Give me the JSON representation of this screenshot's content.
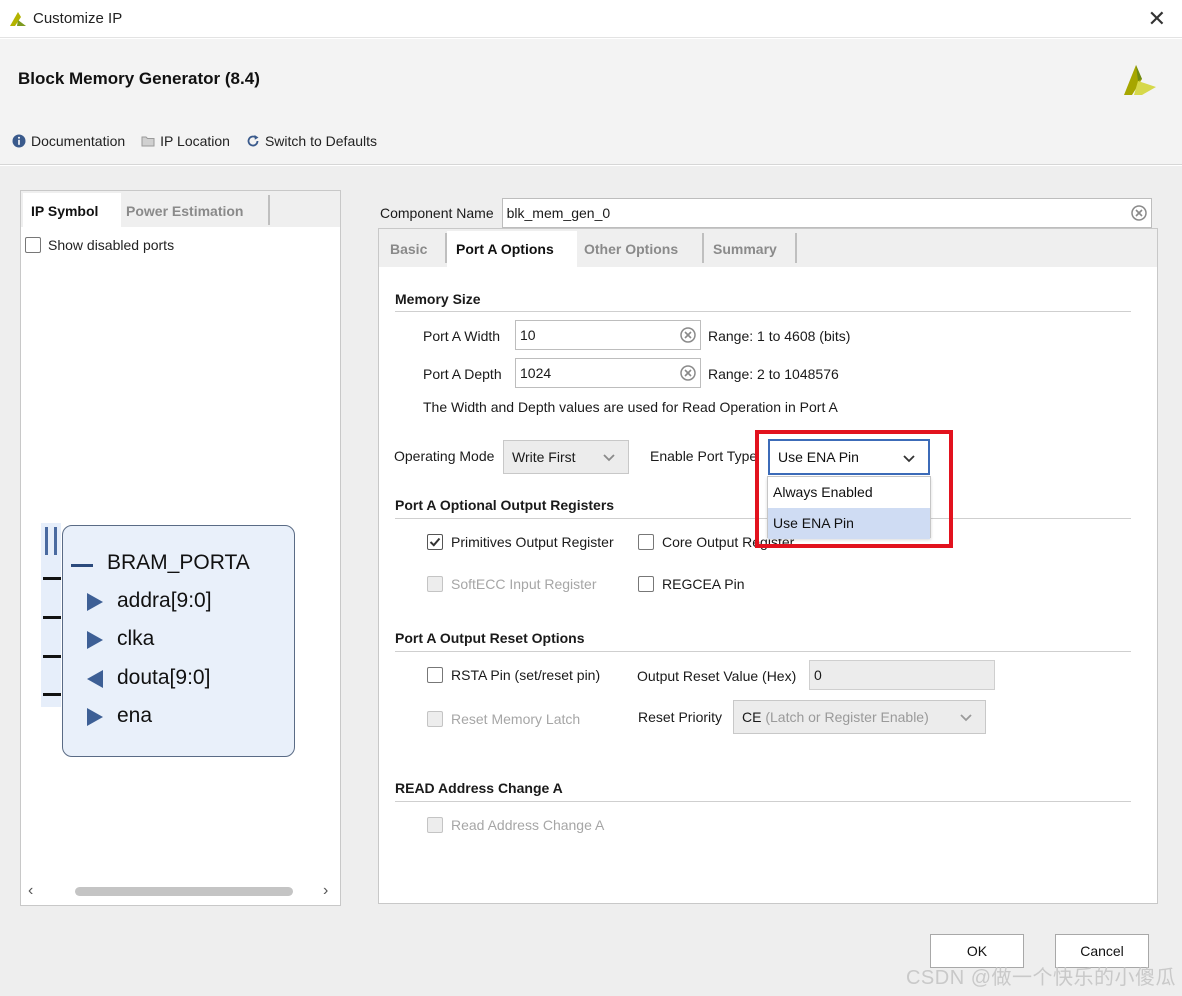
{
  "window": {
    "title": "Customize IP",
    "close_label": "✕"
  },
  "header": {
    "title": "Block Memory Generator (8.4)"
  },
  "toolbar": {
    "documentation": "Documentation",
    "ip_location": "IP Location",
    "switch_defaults": "Switch to Defaults"
  },
  "left_panel": {
    "tabs": [
      {
        "label": "IP Symbol",
        "active": true
      },
      {
        "label": "Power Estimation",
        "active": false
      }
    ],
    "show_disabled_ports": {
      "label": "Show disabled ports",
      "checked": false
    },
    "symbol": {
      "title": "BRAM_PORTA",
      "pins": [
        {
          "name": "addra[9:0]",
          "direction": "in"
        },
        {
          "name": "clka",
          "direction": "in"
        },
        {
          "name": "douta[9:0]",
          "direction": "out"
        },
        {
          "name": "ena",
          "direction": "in"
        }
      ]
    }
  },
  "component": {
    "label": "Component Name",
    "value": "blk_mem_gen_0"
  },
  "tabs": [
    {
      "label": "Basic",
      "active": false
    },
    {
      "label": "Port A Options",
      "active": true
    },
    {
      "label": "Other Options",
      "active": false
    },
    {
      "label": "Summary",
      "active": false
    }
  ],
  "memory_size": {
    "title": "Memory Size",
    "width_label": "Port A Width",
    "width_value": "10",
    "width_range": "Range: 1 to 4608 (bits)",
    "depth_label": "Port A Depth",
    "depth_value": "1024",
    "depth_range": "Range: 2 to 1048576",
    "note": "The Width and Depth values are used for Read Operation in Port A"
  },
  "operating_mode": {
    "label": "Operating Mode",
    "value": "Write First"
  },
  "enable_port": {
    "label": "Enable Port Type",
    "value": "Use ENA Pin",
    "options": [
      "Always Enabled",
      "Use ENA Pin"
    ]
  },
  "output_registers": {
    "title": "Port A Optional Output Registers",
    "primitives": {
      "label": "Primitives Output Register",
      "checked": true
    },
    "core": {
      "label": "Core Output Register",
      "checked": false
    },
    "softecc": {
      "label": "SoftECC Input Register",
      "checked": false,
      "disabled": true
    },
    "regcea": {
      "label": "REGCEA Pin",
      "checked": false
    }
  },
  "reset_options": {
    "title": "Port A Output Reset Options",
    "rsta": {
      "label": "RSTA Pin (set/reset pin)",
      "checked": false
    },
    "reset_value_label": "Output Reset Value (Hex)",
    "reset_value": "0",
    "reset_latch": {
      "label": "Reset Memory Latch",
      "checked": false,
      "disabled": true
    },
    "reset_priority_label": "Reset Priority",
    "reset_priority_value": "CE",
    "reset_priority_detail": "(Latch or Register Enable)"
  },
  "read_address": {
    "title": "READ Address Change A",
    "change": {
      "label": "Read Address Change A",
      "checked": false,
      "disabled": true
    }
  },
  "buttons": {
    "ok": "OK",
    "cancel": "Cancel"
  },
  "watermark": "CSDN @做一个快乐的小傻瓜",
  "colors": {
    "accent": "#3c6bb8",
    "highlight": "#e2121e",
    "symbol_fill": "#e9f0fa",
    "selection": "#cfdcf3"
  }
}
